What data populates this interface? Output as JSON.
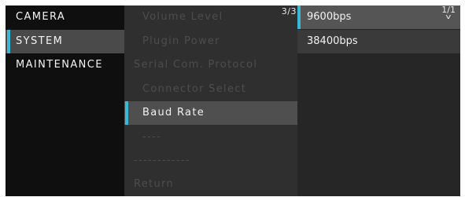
{
  "categories": [
    {
      "label": "CAMERA"
    },
    {
      "label": "SYSTEM"
    },
    {
      "label": "MAINTENANCE"
    }
  ],
  "submenu": {
    "page": "3/3",
    "items": [
      {
        "label": "Volume Level"
      },
      {
        "label": "Plugin Power"
      },
      {
        "label": "Serial Com. Protocol"
      },
      {
        "label": "Connector Select"
      },
      {
        "label": "Baud Rate"
      },
      {
        "label": "----"
      },
      {
        "label": "------------"
      },
      {
        "label": "Return"
      }
    ]
  },
  "options": {
    "page": "1/1",
    "items": [
      {
        "label": "9600bps"
      },
      {
        "label": "38400bps"
      }
    ]
  },
  "colors": {
    "accent": "#39b9d6"
  },
  "icons": {
    "scroll": "chevron-down-icon"
  }
}
